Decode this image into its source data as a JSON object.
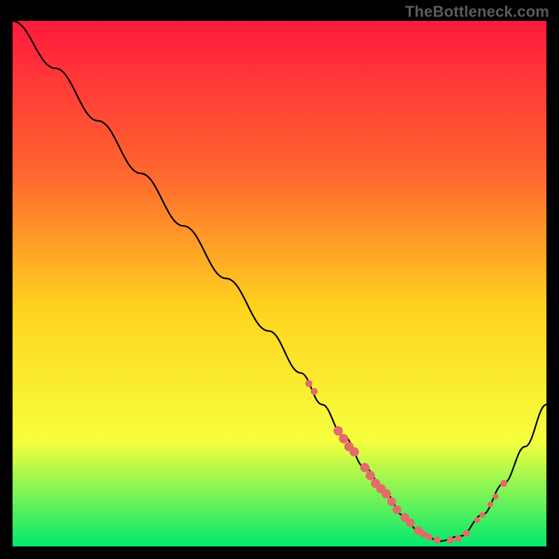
{
  "watermark": "TheBottleneck.com",
  "colors": {
    "gradient_top": "#ff1a3d",
    "gradient_mid_upper": "#ff6a2e",
    "gradient_mid": "#ffd41f",
    "gradient_lower": "#f6ff3d",
    "gradient_bottom": "#02e86f",
    "curve": "#000000",
    "marker": "#e56a6a",
    "frame_bg": "#000000"
  },
  "chart_data": {
    "type": "line",
    "title": "",
    "xlabel": "",
    "ylabel": "",
    "xlim": [
      0,
      100
    ],
    "ylim": [
      0,
      100
    ],
    "series": [
      {
        "name": "bottleneck-curve",
        "x": [
          0,
          8,
          16,
          24,
          32,
          40,
          48,
          54,
          58,
          62,
          66,
          70,
          73,
          76,
          80,
          84,
          88,
          92,
          96,
          100
        ],
        "y": [
          100,
          91,
          81,
          71,
          61,
          51,
          41,
          33,
          27,
          21,
          15,
          10,
          6,
          3,
          1,
          2,
          6,
          12,
          19,
          27
        ]
      }
    ],
    "markers": [
      {
        "x": 55.5,
        "y": 31,
        "r": 1.2
      },
      {
        "x": 56.5,
        "y": 29.5,
        "r": 1.2
      },
      {
        "x": 61,
        "y": 22,
        "r": 1.6
      },
      {
        "x": 62,
        "y": 20.5,
        "r": 1.6
      },
      {
        "x": 63,
        "y": 19,
        "r": 1.6
      },
      {
        "x": 64,
        "y": 18,
        "r": 1.6
      },
      {
        "x": 66,
        "y": 15,
        "r": 1.6
      },
      {
        "x": 67,
        "y": 13.5,
        "r": 1.6
      },
      {
        "x": 68,
        "y": 12,
        "r": 1.6
      },
      {
        "x": 69,
        "y": 11,
        "r": 1.6
      },
      {
        "x": 70,
        "y": 10,
        "r": 1.6
      },
      {
        "x": 71,
        "y": 8.5,
        "r": 1.5
      },
      {
        "x": 72,
        "y": 7,
        "r": 1.5
      },
      {
        "x": 73.5,
        "y": 5.5,
        "r": 1.5
      },
      {
        "x": 74.5,
        "y": 4.5,
        "r": 1.5
      },
      {
        "x": 76,
        "y": 3,
        "r": 1.5
      },
      {
        "x": 77,
        "y": 2.3,
        "r": 1.2
      },
      {
        "x": 78,
        "y": 1.8,
        "r": 1.2
      },
      {
        "x": 79.5,
        "y": 1.2,
        "r": 1.2
      },
      {
        "x": 82,
        "y": 1.2,
        "r": 1.2
      },
      {
        "x": 83.5,
        "y": 1.5,
        "r": 1.2
      },
      {
        "x": 85,
        "y": 2.5,
        "r": 1.2
      },
      {
        "x": 87,
        "y": 5,
        "r": 1.0
      },
      {
        "x": 88,
        "y": 6,
        "r": 1.0
      },
      {
        "x": 89.5,
        "y": 8,
        "r": 1.0
      },
      {
        "x": 90.5,
        "y": 9.5,
        "r": 1.0
      },
      {
        "x": 92,
        "y": 12,
        "r": 1.2
      }
    ]
  }
}
